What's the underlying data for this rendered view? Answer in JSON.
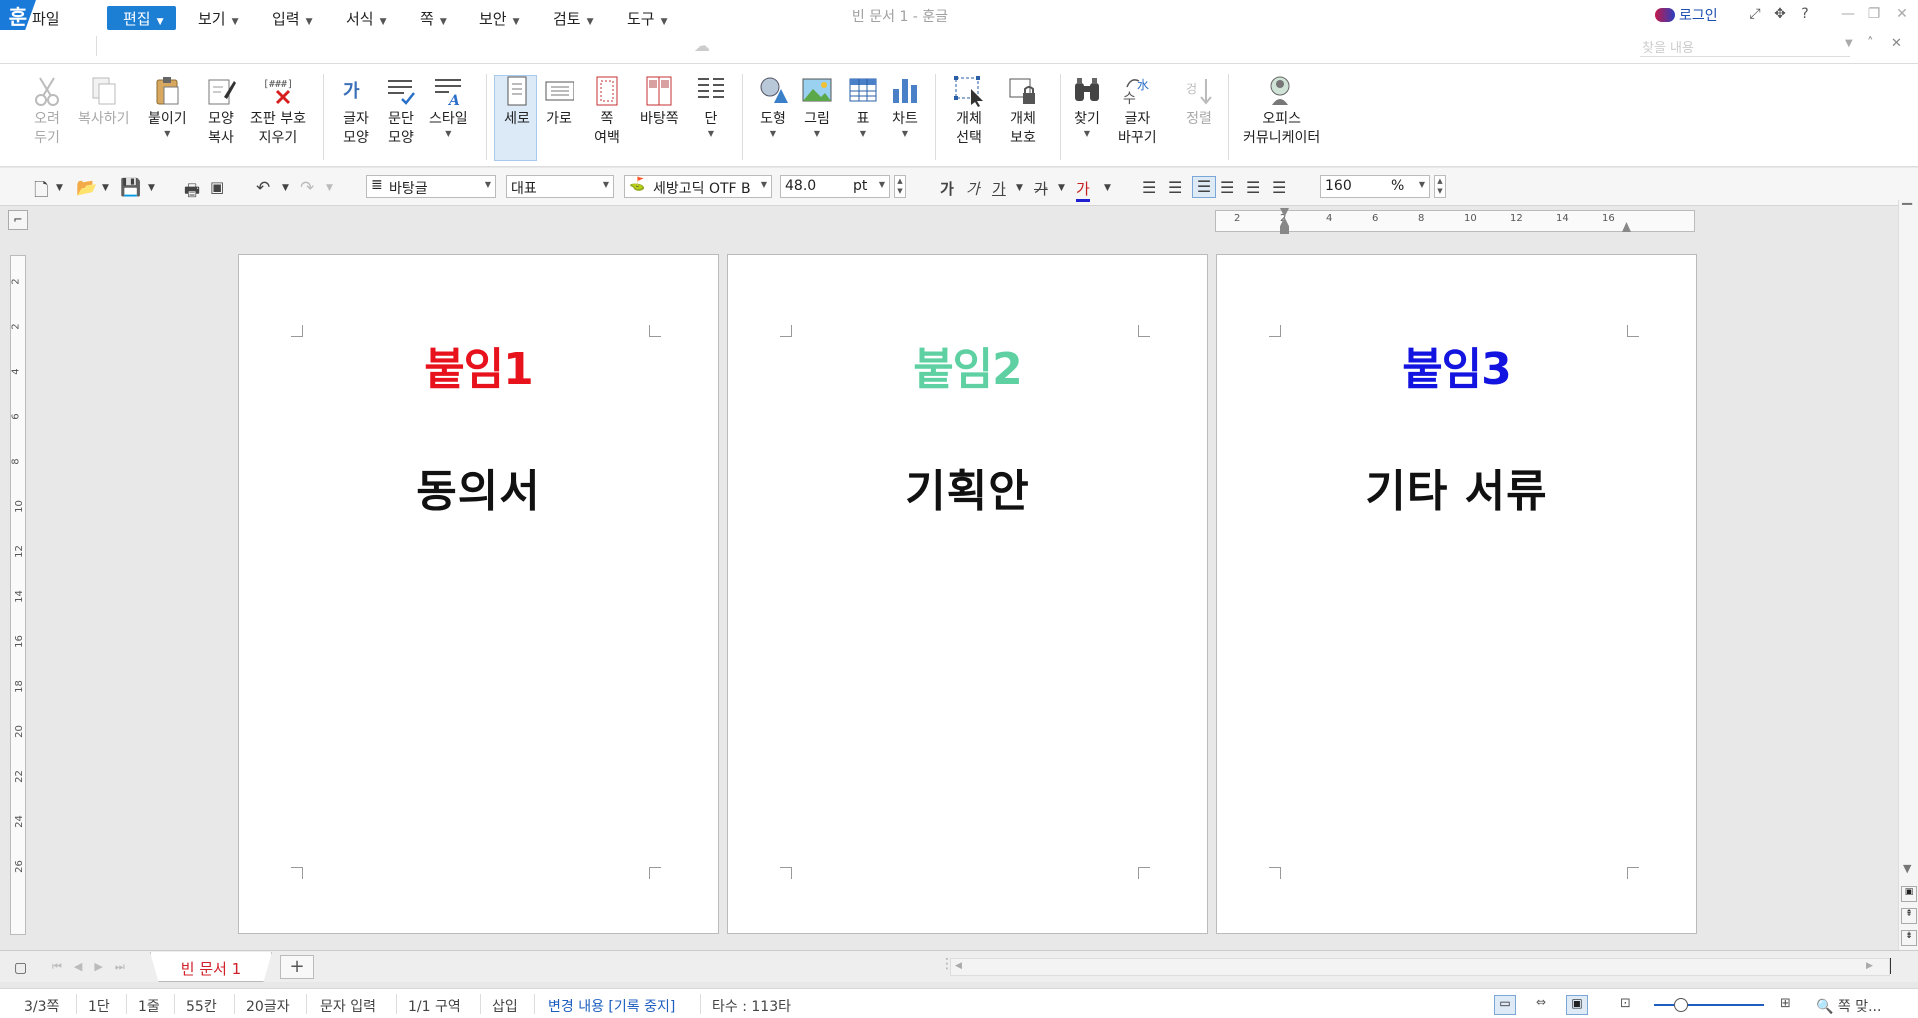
{
  "app": {
    "logo": "훈",
    "title": "빈 문서 1 - 훈글",
    "login": "로그인"
  },
  "title_icons": [
    "fullscreen-icon",
    "move-icon",
    "help-icon",
    "minimize-icon",
    "restore-icon",
    "close-icon"
  ],
  "menu": {
    "file": "파일",
    "edit": "편집",
    "view": "보기",
    "input": "입력",
    "format": "서식",
    "page": "쪽",
    "security": "보안",
    "review": "검토",
    "tools": "도구",
    "search_placeholder": "찾을 내용"
  },
  "ribbon": {
    "cut": [
      "오려",
      "두기"
    ],
    "copy": "복사하기",
    "paste": "붙이기",
    "format_copy": [
      "모양",
      "복사"
    ],
    "clear_marks": [
      "조판 부호",
      "지우기"
    ],
    "char_shape": [
      "글자",
      "모양"
    ],
    "para_shape": [
      "문단",
      "모양"
    ],
    "style": "스타일",
    "portrait": "세로",
    "landscape": "가로",
    "margin": [
      "쪽",
      "여백"
    ],
    "background": "바탕쪽",
    "column": "단",
    "shape": "도형",
    "picture": "그림",
    "table": "표",
    "chart": "차트",
    "obj_select": [
      "개체",
      "선택"
    ],
    "obj_protect": [
      "개체",
      "보호"
    ],
    "find": "찾기",
    "replace": [
      "글자",
      "바꾸기"
    ],
    "sort": "정렬",
    "office": [
      "오피스",
      "커뮤니케이터"
    ]
  },
  "format": {
    "style": "바탕글",
    "lang": "대표",
    "font": "세방고딕 OTF B",
    "size": "48.0",
    "size_unit": "pt",
    "zoom": "160",
    "zoom_unit": "%"
  },
  "ruler_h": [
    "2",
    "2",
    "4",
    "6",
    "8",
    "10",
    "12",
    "14",
    "16"
  ],
  "ruler_v": [
    "2",
    "2",
    "4",
    "6",
    "8",
    "10",
    "12",
    "14",
    "16",
    "18",
    "20",
    "22",
    "24",
    "26"
  ],
  "pages": [
    {
      "title": "붙임1",
      "body": "동의서",
      "color": "#e8121d"
    },
    {
      "title": "붙임2",
      "body": "기획안",
      "color": "#5fd0a2"
    },
    {
      "title": "붙임3",
      "body": "기타 서류",
      "color": "#1414e0"
    }
  ],
  "tabs": {
    "doc": "빈 문서 1",
    "add": "+"
  },
  "status": {
    "page": "3/3쪽",
    "col": "1단",
    "line": "1줄",
    "char": "55칸",
    "chars": "20글자",
    "mode": "문자 입력",
    "section": "1/1 구역",
    "insert": "삽입",
    "track": "변경 내용 [기록 중지]",
    "keystroke": "타수 : 113타",
    "fit": "쪽 맞..."
  }
}
